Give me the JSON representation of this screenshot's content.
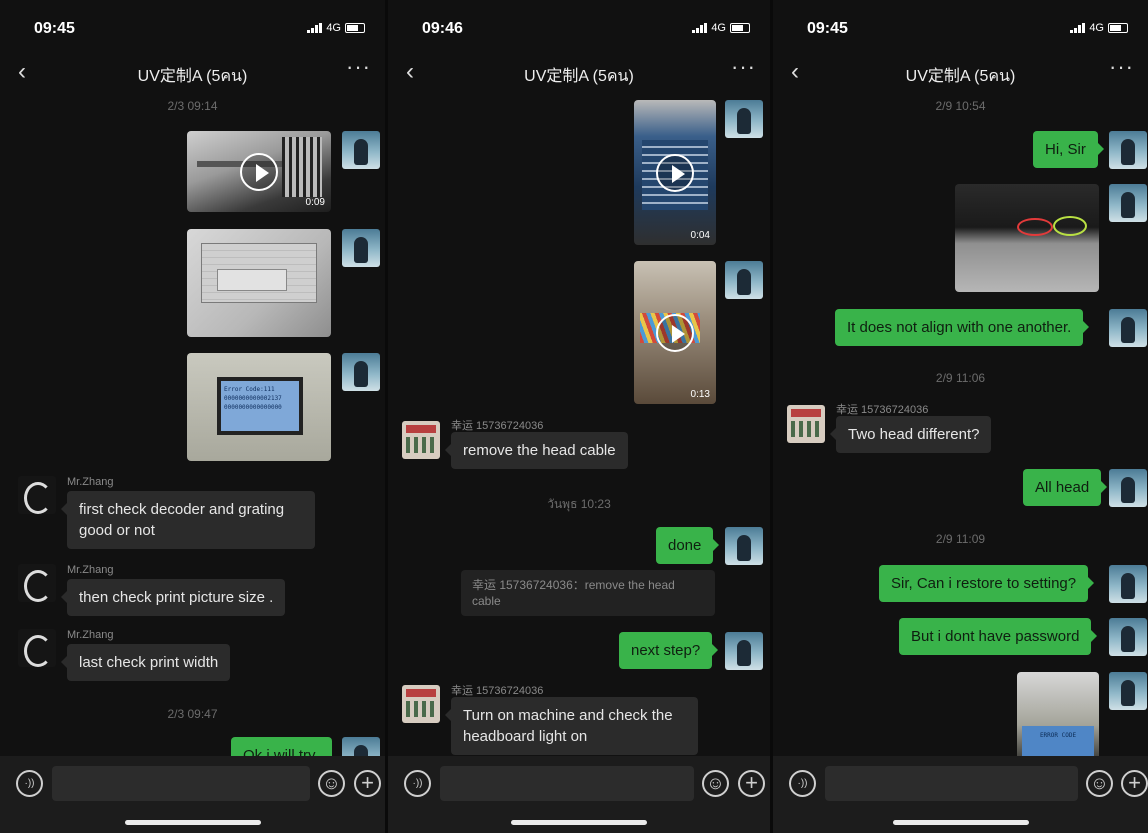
{
  "panels": [
    {
      "time": "09:45",
      "network": "4G",
      "title": "UV定制A (5คน)",
      "timestamps": [
        "2/3 09:14",
        "2/3 09:47"
      ],
      "video1_duration": "0:09",
      "screen_text": [
        "Error Code:111",
        "0000000000002137",
        "0000000000000000"
      ],
      "sender": "Mr.Zhang",
      "messages": [
        "first check decoder and grating good or not",
        "then check print picture size .",
        "last check print width",
        "Ok,i will try"
      ]
    },
    {
      "time": "09:46",
      "network": "4G",
      "title": "UV定制A (5คน)",
      "timestamps": [
        "วันพุธ 10:23"
      ],
      "video1_duration": "0:04",
      "video2_duration": "0:13",
      "sender": "幸运 15736724036",
      "messages": [
        "remove the head cable",
        "done",
        "next step?",
        "Turn on machine and check the headboard light on"
      ],
      "quote": "幸运 15736724036：remove the head cable"
    },
    {
      "time": "09:45",
      "network": "4G",
      "title": "UV定制A (5คน)",
      "timestamps": [
        "2/9 10:54",
        "2/9 11:06",
        "2/9 11:09"
      ],
      "sender": "幸运 15736724036",
      "messages": [
        "Hi, Sir",
        "It does not align with one another.",
        "Two head different?",
        "All head",
        "Sir, Can i restore to setting?",
        "But i dont have password"
      ],
      "screen_text": "ERROR CODE"
    }
  ],
  "icons": {
    "back": "‹",
    "more": "···",
    "voice": "·))",
    "emoji": "☺",
    "plus": "+"
  }
}
